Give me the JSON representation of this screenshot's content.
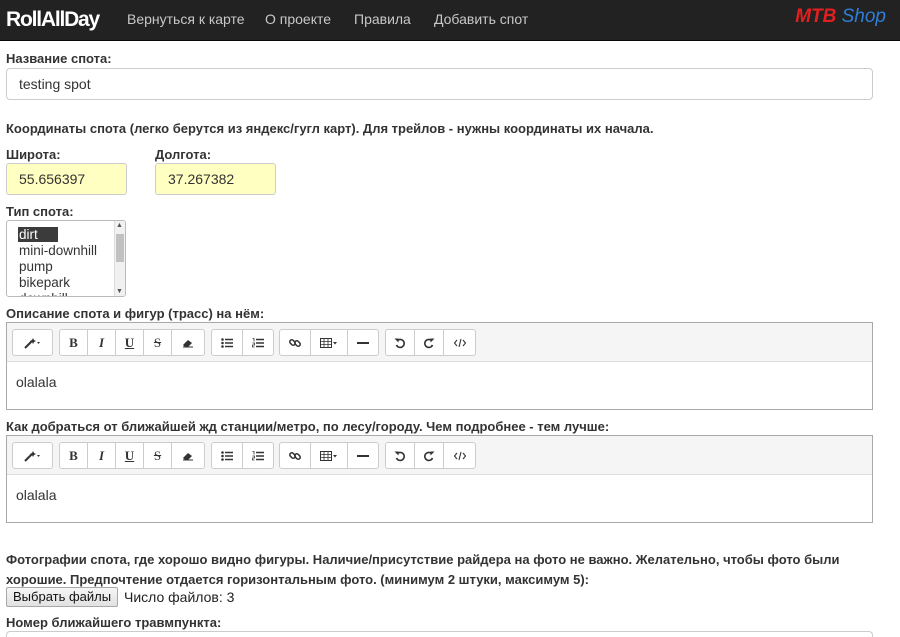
{
  "navbar": {
    "brand": "RollAllDay",
    "links": [
      "Вернуться к карте",
      "О проекте",
      "Правила",
      "Добавить спот"
    ],
    "shop_logo": {
      "part1": "MTB",
      "part2": "Shop"
    }
  },
  "form": {
    "spot_name_label": "Название спота:",
    "spot_name_value": "testing spot",
    "coords_hint": "Координаты спота (легко берутся из яндекс/гугл карт). Для трейлов - нужны координаты их начала.",
    "lat_label": "Широта:",
    "lat_value": "55.656397",
    "lon_label": "Долгота:",
    "lon_value": "37.267382",
    "type_label": "Тип спота:",
    "type_options": [
      "dirt",
      "mini-downhill",
      "pump",
      "bikepark",
      "downhill"
    ],
    "type_selected": "dirt",
    "desc_label": "Описание спота и фигур (трасс) на нём:",
    "desc_value": "olalala",
    "route_label": "Как добраться от ближайшей жд станции/метро, по лесу/городу. Чем подробнее - тем лучше:",
    "route_value": "olalala",
    "photos_label": "Фотографии спота, где хорошо видно фигуры. Наличие/присутствие райдера на фото не важно. Желательно, чтобы фото были хорошие. Предпочтение отдается горизонтальным фото. (минимум 2 штуки, максимум 5):",
    "upload_button": "Выбрать файлы",
    "file_count": "Число файлов: 3",
    "trauma_label": "Номер ближайшего травмпункта:"
  },
  "toolbar_icons": [
    "magic-icon",
    "bold-icon",
    "italic-icon",
    "underline-icon",
    "strikethrough-icon",
    "eraser-icon",
    "unordered-list-icon",
    "ordered-list-icon",
    "link-icon",
    "table-icon",
    "horizontal-rule-icon",
    "undo-icon",
    "redo-icon",
    "code-view-icon"
  ],
  "colors": {
    "navbar_bg": "#222222",
    "coord_bg": "#ffffc2",
    "mtb_red": "#e02020",
    "shop_blue": "#2f7ed8"
  }
}
